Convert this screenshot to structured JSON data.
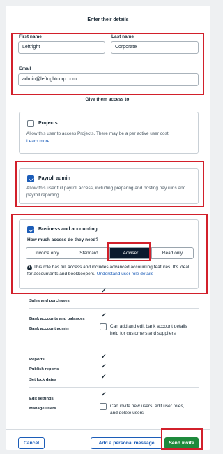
{
  "header": {
    "title": "Enter their details"
  },
  "form": {
    "first_name_label": "First name",
    "first_name_value": "Leftright",
    "last_name_label": "Last name",
    "last_name_value": "Corporate",
    "email_label": "Email",
    "email_value": "admin@leftrightcorp.com"
  },
  "access": {
    "heading": "Give them access to:",
    "projects": {
      "title": "Projects",
      "checked": false,
      "desc": "Allow this user to access Projects. There may be a per active user cost.",
      "link": "Learn more"
    },
    "payroll": {
      "title": "Payroll admin",
      "checked": true,
      "desc": "Allow this user full payroll access, including preparing and posting pay runs and payroll reporting"
    },
    "business": {
      "title": "Business and accounting",
      "checked": true,
      "question": "How much access do they need?",
      "options": [
        "Invoice only",
        "Standard",
        "Adviser",
        "Read only"
      ],
      "selected": "Adviser",
      "info_text": "This role has full access and includes advanced accounting features. It's ideal for accountants and bookkeepers.",
      "info_link": "Understand user role details"
    }
  },
  "permissions": {
    "sales_and_purchases": "Sales and purchases",
    "bank_accounts_and_balances": "Bank accounts and balances",
    "bank_account_admin": "Bank account admin",
    "bank_account_admin_desc": "Can add and edit bank account details held for customers and suppliers",
    "reports": "Reports",
    "publish_reports": "Publish reports",
    "set_lock_dates": "Set lock dates",
    "edit_settings": "Edit settings",
    "manage_users": "Manage users",
    "manage_users_desc": "Can invite new users, edit user roles, and delete users"
  },
  "footer": {
    "cancel": "Cancel",
    "personal_message": "Add a personal message",
    "send_invite": "Send invite"
  }
}
